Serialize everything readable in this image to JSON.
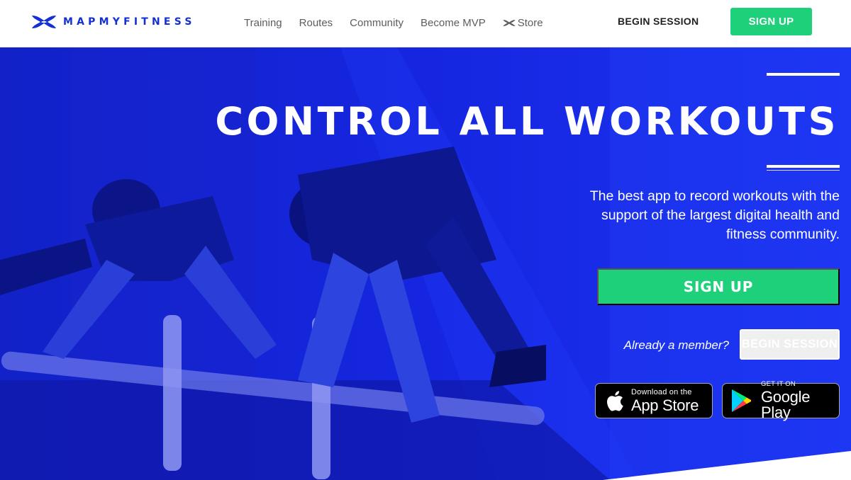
{
  "brand": {
    "name": "MAPMYFITNESS",
    "colors": {
      "brand_blue": "#1330d6",
      "hero_blue": "#1a2cf0",
      "accent_green": "#1fd07a",
      "nav_gray": "#5d5d5d"
    }
  },
  "nav": {
    "items": [
      {
        "label": "Training"
      },
      {
        "label": "Routes"
      },
      {
        "label": "Community"
      },
      {
        "label": "Become MVP"
      },
      {
        "label": "Store",
        "icon": "under-armour-icon"
      }
    ],
    "begin_session": "BEGIN SESSION",
    "sign_up": "SIGN UP"
  },
  "hero": {
    "headline": "CONTROL ALL WORKOUTS",
    "subtitle": "The best app to record workouts with the support of the largest digital health and fitness community.",
    "cta_signup": "SIGN UP",
    "member_prompt": "Already a member?",
    "cta_begin_session": "BEGIN SESSION",
    "badges": {
      "apple": {
        "small": "Download on the",
        "big": "App Store",
        "icon": "apple-icon"
      },
      "google": {
        "small": "GET IT ON",
        "big": "Google Play",
        "icon": "google-play-icon"
      }
    }
  }
}
